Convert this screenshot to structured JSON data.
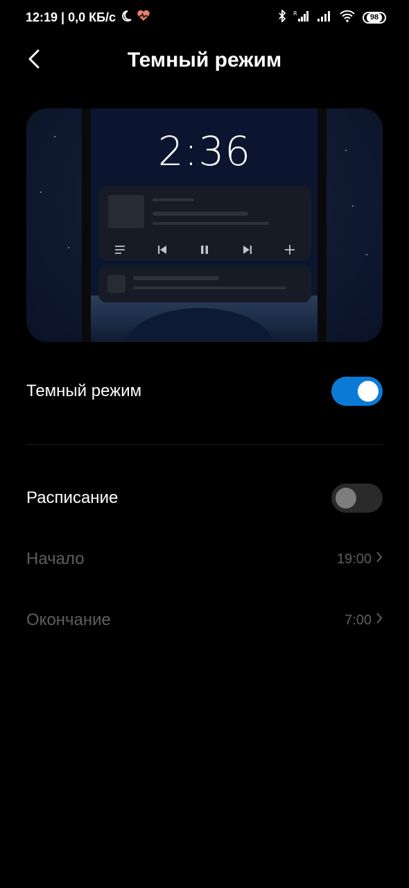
{
  "status_bar": {
    "time_info": "12:19 | 0,0 КБ/с",
    "battery": "98",
    "icons": [
      "moon-icon",
      "heart-icon",
      "bluetooth-icon",
      "signal-roaming-icon",
      "signal-icon",
      "wifi-icon"
    ]
  },
  "header": {
    "back_icon": "chevron-left-icon",
    "title": "Темный режим"
  },
  "preview": {
    "clock": "2:36",
    "controls": [
      "list-icon",
      "skip-previous-icon",
      "pause-icon",
      "skip-next-icon",
      "plus-icon"
    ]
  },
  "settings": {
    "dark_mode": {
      "label": "Темный режим",
      "enabled": true
    },
    "schedule": {
      "label": "Расписание",
      "enabled": false
    },
    "start": {
      "label": "Начало",
      "value": "19:00"
    },
    "end": {
      "label": "Окончание",
      "value": "7:00"
    }
  },
  "colors": {
    "accent": "#0b7ad7",
    "background": "#000000",
    "muted_text": "#5e5e5e"
  }
}
